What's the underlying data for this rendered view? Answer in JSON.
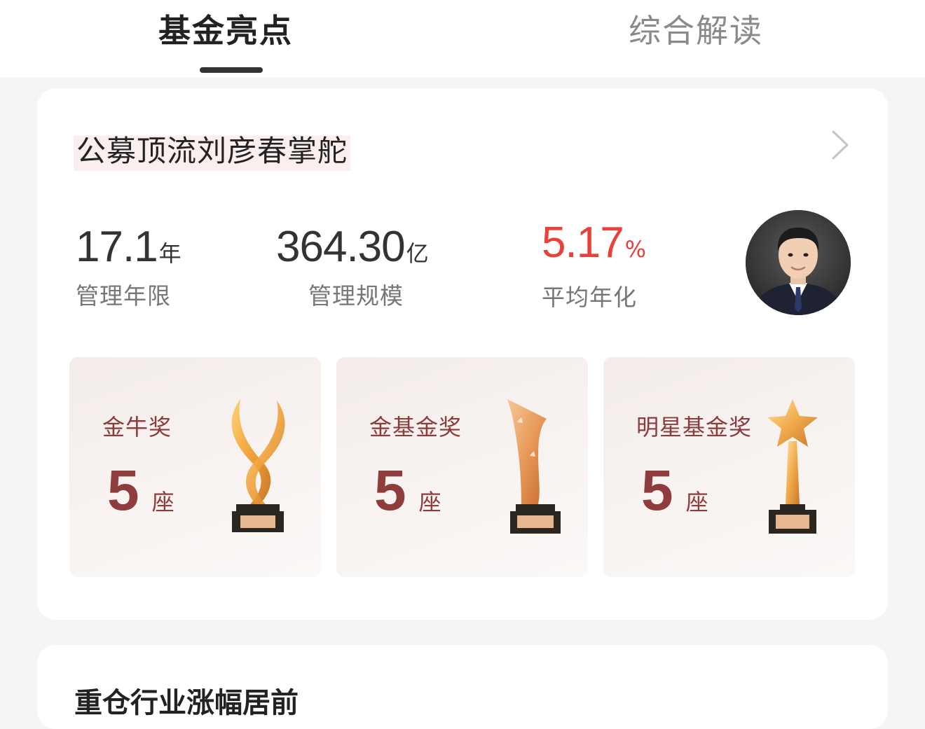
{
  "tabs": {
    "active": "基金亮点",
    "inactive": "综合解读"
  },
  "card": {
    "headline": "公募顶流刘彦春掌舵",
    "metrics": [
      {
        "value": "17.1",
        "unit": "年",
        "label": "管理年限"
      },
      {
        "value": "364.30",
        "unit": "亿",
        "label": "管理规模"
      },
      {
        "value": "5.17",
        "unit": "%",
        "label": "平均年化"
      }
    ],
    "awards": [
      {
        "name": "金牛奖",
        "count": "5",
        "unit": "座",
        "icon": "bull-horn-trophy-icon"
      },
      {
        "name": "金基金奖",
        "count": "5",
        "unit": "座",
        "icon": "flag-trophy-icon"
      },
      {
        "name": "明星基金奖",
        "count": "5",
        "unit": "座",
        "icon": "star-trophy-icon"
      }
    ]
  },
  "next_card": {
    "title": "重仓行业涨幅居前"
  },
  "colors": {
    "positive": "#e8403a",
    "award_text": "#8e3c3c",
    "tab_indicator": "#333333"
  }
}
